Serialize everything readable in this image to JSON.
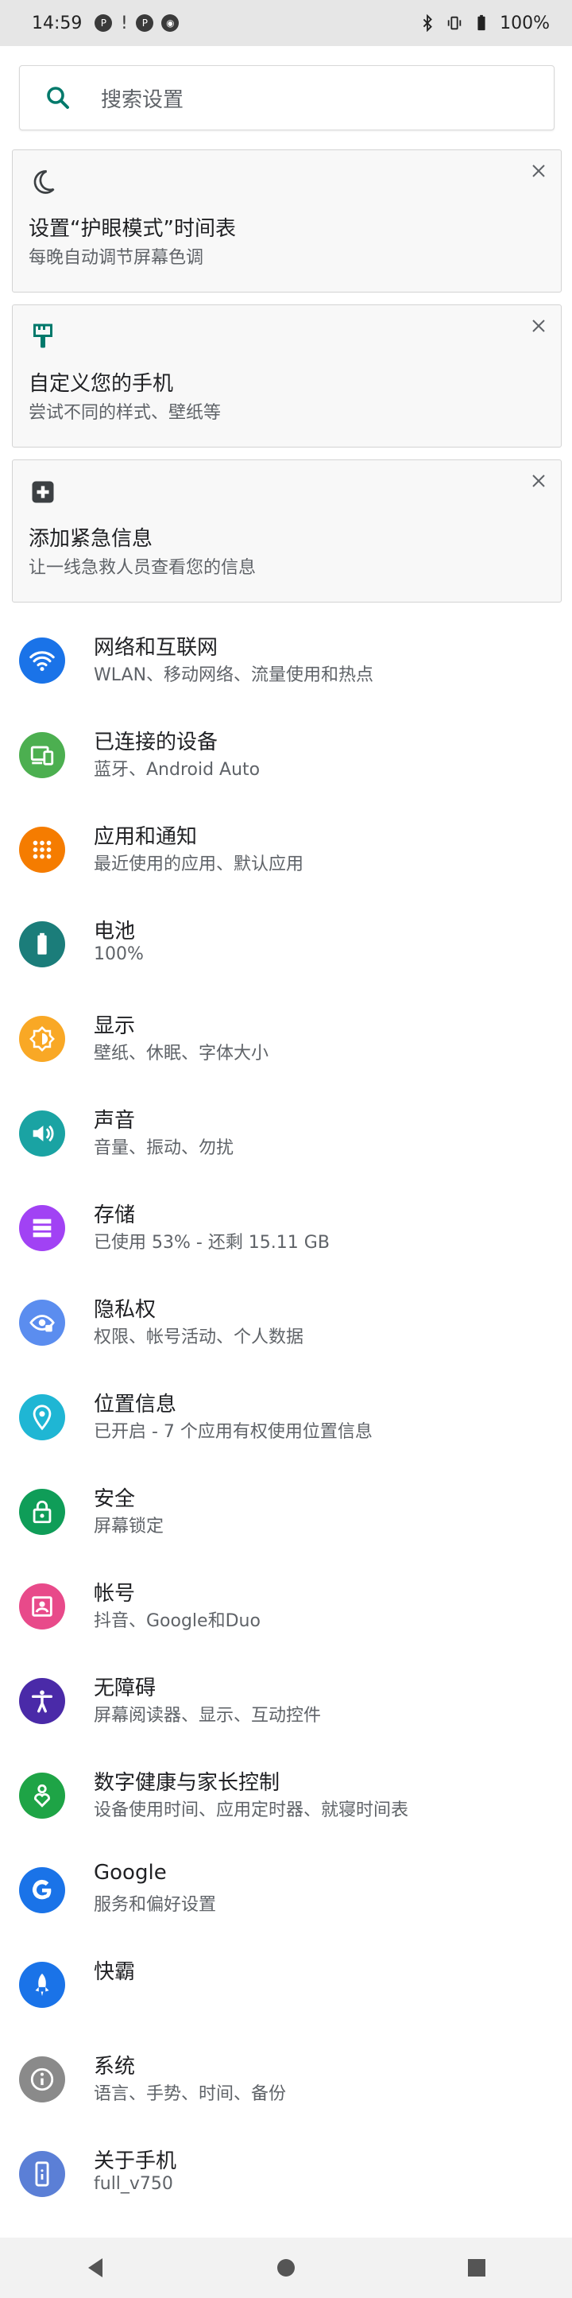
{
  "status_bar": {
    "time": "14:59",
    "battery": "100%"
  },
  "search": {
    "placeholder": "搜索设置"
  },
  "cards": [
    {
      "title": "设置“护眼模式”时间表",
      "subtitle": "每晚自动调节屏幕色调",
      "icon": "moon-icon"
    },
    {
      "title": "自定义您的手机",
      "subtitle": "尝试不同的样式、壁纸等",
      "icon": "paintbrush-icon"
    },
    {
      "title": "添加紧急信息",
      "subtitle": "让一线急救人员查看您的信息",
      "icon": "medical-plus-icon"
    }
  ],
  "settings": [
    {
      "title": "网络和互联网",
      "subtitle": "WLAN、移动网络、流量使用和热点",
      "color": "#1a73e8",
      "icon": "wifi-icon"
    },
    {
      "title": "已连接的设备",
      "subtitle": "蓝牙、Android Auto",
      "color": "#4caf50",
      "icon": "devices-icon"
    },
    {
      "title": "应用和通知",
      "subtitle": "最近使用的应用、默认应用",
      "color": "#f57c00",
      "icon": "apps-grid-icon"
    },
    {
      "title": "电池",
      "subtitle": "100%",
      "color": "#1b7d7a",
      "icon": "battery-icon"
    },
    {
      "title": "显示",
      "subtitle": "壁纸、休眠、字体大小",
      "color": "#f9a825",
      "icon": "brightness-icon"
    },
    {
      "title": "声音",
      "subtitle": "音量、振动、勿扰",
      "color": "#1aa3a3",
      "icon": "volume-icon"
    },
    {
      "title": "存储",
      "subtitle": "已使用 53% - 还剩 15.11 GB",
      "color": "#a142f4",
      "icon": "storage-icon"
    },
    {
      "title": "隐私权",
      "subtitle": "权限、帐号活动、个人数据",
      "color": "#5b8def",
      "icon": "privacy-eye-icon"
    },
    {
      "title": "位置信息",
      "subtitle": "已开启 - 7 个应用有权使用位置信息",
      "color": "#1fb6d4",
      "icon": "location-pin-icon"
    },
    {
      "title": "安全",
      "subtitle": "屏幕锁定",
      "color": "#0f9d58",
      "icon": "lock-icon"
    },
    {
      "title": "帐号",
      "subtitle": "抖音、Google和Duo",
      "color": "#e84a8a",
      "icon": "account-box-icon"
    },
    {
      "title": "无障碍",
      "subtitle": "屏幕阅读器、显示、互动控件",
      "color": "#4a2aa8",
      "icon": "accessibility-icon"
    },
    {
      "title": "数字健康与家长控制",
      "subtitle": "设备使用时间、应用定时器、就寝时间表",
      "color": "#1ea446",
      "icon": "wellbeing-icon"
    },
    {
      "title": "Google",
      "subtitle": "服务和偏好设置",
      "color": "#1a73e8",
      "icon": "google-icon"
    },
    {
      "title": "快霸",
      "subtitle": "",
      "color": "#1a73e8",
      "icon": "rocket-icon"
    },
    {
      "title": "系统",
      "subtitle": "语言、手势、时间、备份",
      "color": "#8a8a8a",
      "icon": "info-icon"
    },
    {
      "title": "关于手机",
      "subtitle": "full_v750",
      "color": "#5b7fd6",
      "icon": "phone-icon"
    }
  ]
}
